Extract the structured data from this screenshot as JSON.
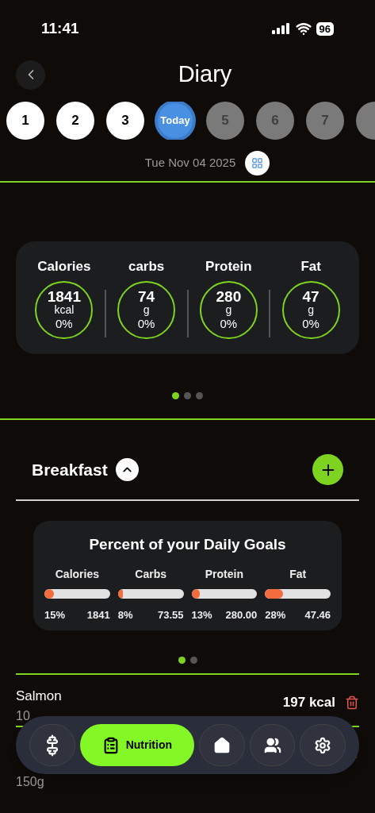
{
  "status_bar": {
    "time": "11:41",
    "battery": "96"
  },
  "header": {
    "title": "Diary"
  },
  "days": [
    {
      "label": "1",
      "kind": "past",
      "selected": false
    },
    {
      "label": "2",
      "kind": "past",
      "selected": false
    },
    {
      "label": "3",
      "kind": "past",
      "selected": false
    },
    {
      "label": "Today",
      "kind": "today",
      "selected": true
    },
    {
      "label": "5",
      "kind": "future",
      "selected": false
    },
    {
      "label": "6",
      "kind": "future",
      "selected": false
    },
    {
      "label": "7",
      "kind": "future",
      "selected": false
    }
  ],
  "date": "Tue Nov 04 2025",
  "summary": [
    {
      "name": "Calories",
      "value": "1841",
      "unit": "kcal",
      "percent": "0%"
    },
    {
      "name": "carbs",
      "value": "74",
      "unit": "g",
      "percent": "0%"
    },
    {
      "name": "Protein",
      "value": "280",
      "unit": "g",
      "percent": "0%"
    },
    {
      "name": "Fat",
      "value": "47",
      "unit": "g",
      "percent": "0%"
    }
  ],
  "summary_pager": [
    {
      "selected": true
    },
    {
      "selected": false
    },
    {
      "selected": false
    }
  ],
  "meal": {
    "title": "Breakfast",
    "expanded": true
  },
  "goals": {
    "title": "Percent of your Daily Goals",
    "items": [
      {
        "name": "Calories",
        "level": 0.15,
        "percent": "15%",
        "amount": "1841"
      },
      {
        "name": "Carbs",
        "level": 0.08,
        "percent": "8%",
        "amount": "73.55"
      },
      {
        "name": "Protein",
        "level": 0.13,
        "percent": "13%",
        "amount": "280.00"
      },
      {
        "name": "Fat",
        "level": 0.28,
        "percent": "28%",
        "amount": "47.46"
      }
    ]
  },
  "goals_pager": [
    {
      "selected": true
    },
    {
      "selected": false
    }
  ],
  "foods": [
    {
      "name": "Salmon",
      "amount": "10",
      "kcal": "197 kcal"
    },
    {
      "amount": "150g"
    }
  ],
  "nav": [
    {
      "kind": "workout",
      "selected": false
    },
    {
      "kind": "nutrition",
      "label": "Nutrition",
      "selected": true
    },
    {
      "kind": "home",
      "selected": false
    },
    {
      "kind": "community",
      "selected": false
    },
    {
      "kind": "settings",
      "selected": false
    }
  ]
}
